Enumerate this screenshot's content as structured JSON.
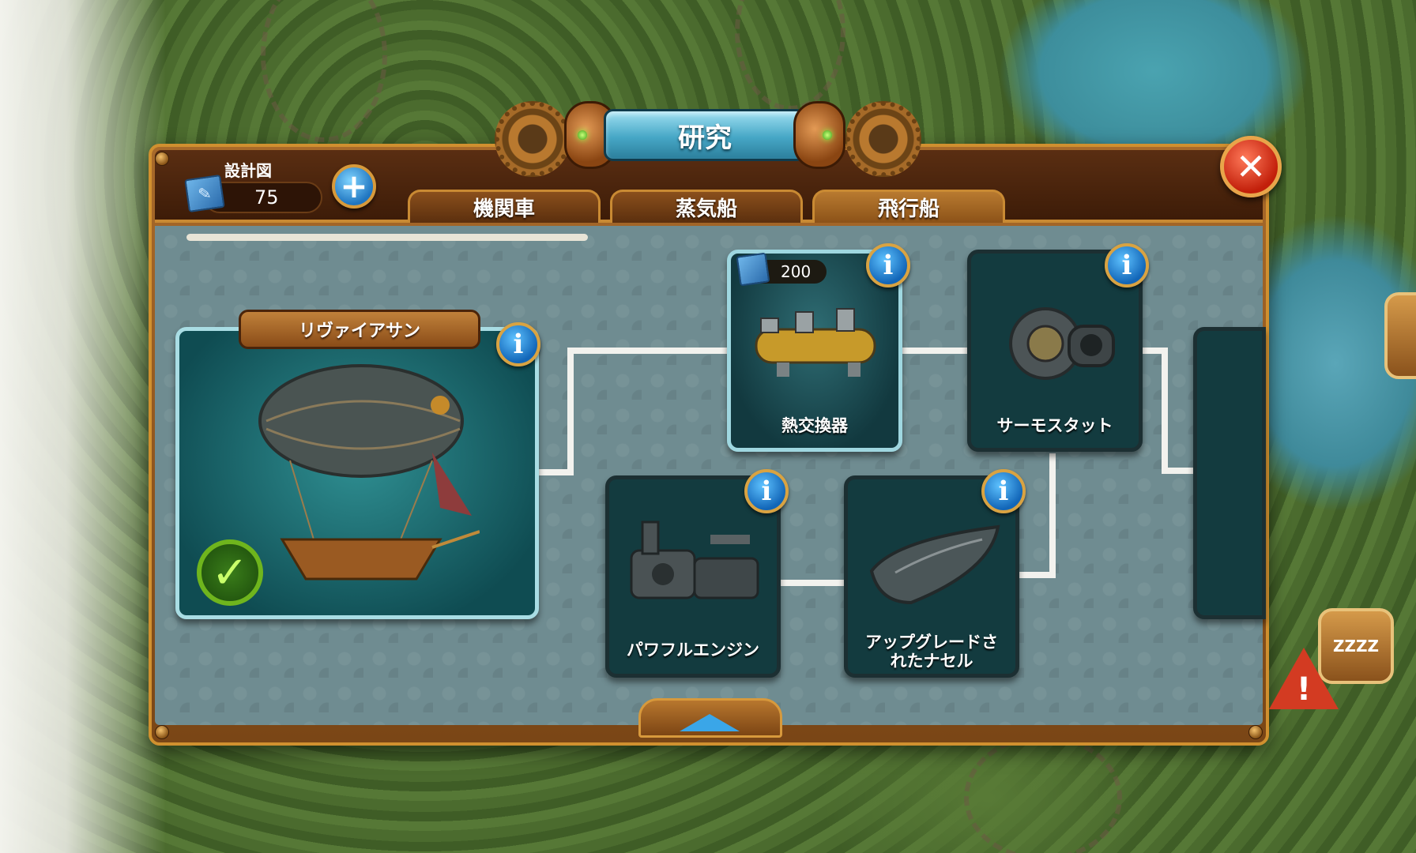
{
  "window": {
    "title": "研究"
  },
  "header": {
    "blueprint_label": "設計図",
    "blueprint_count": "75",
    "tabs": [
      {
        "label": "機関車",
        "active": false
      },
      {
        "label": "蒸気船",
        "active": false
      },
      {
        "label": "飛行船",
        "active": true
      }
    ]
  },
  "research": {
    "main_item": {
      "name": "リヴァイアサン",
      "completed": true
    },
    "nodes": [
      {
        "label": "熱交換器",
        "cost": "200"
      },
      {
        "label": "サーモスタット"
      },
      {
        "label": "パワフルエンジン"
      },
      {
        "label": "アップグレードされたナセル"
      }
    ]
  },
  "icons": {
    "info": "i",
    "plus": "+",
    "close": "✕",
    "check": "✓",
    "sleep": "ZZZZ",
    "warning": "!"
  },
  "colors": {
    "panel_wood": "#8a4f1c",
    "content_bg": "#6f8c91",
    "info_blue": "#1266b8",
    "close_red": "#c21f0a",
    "check_green": "#6fb51d"
  }
}
